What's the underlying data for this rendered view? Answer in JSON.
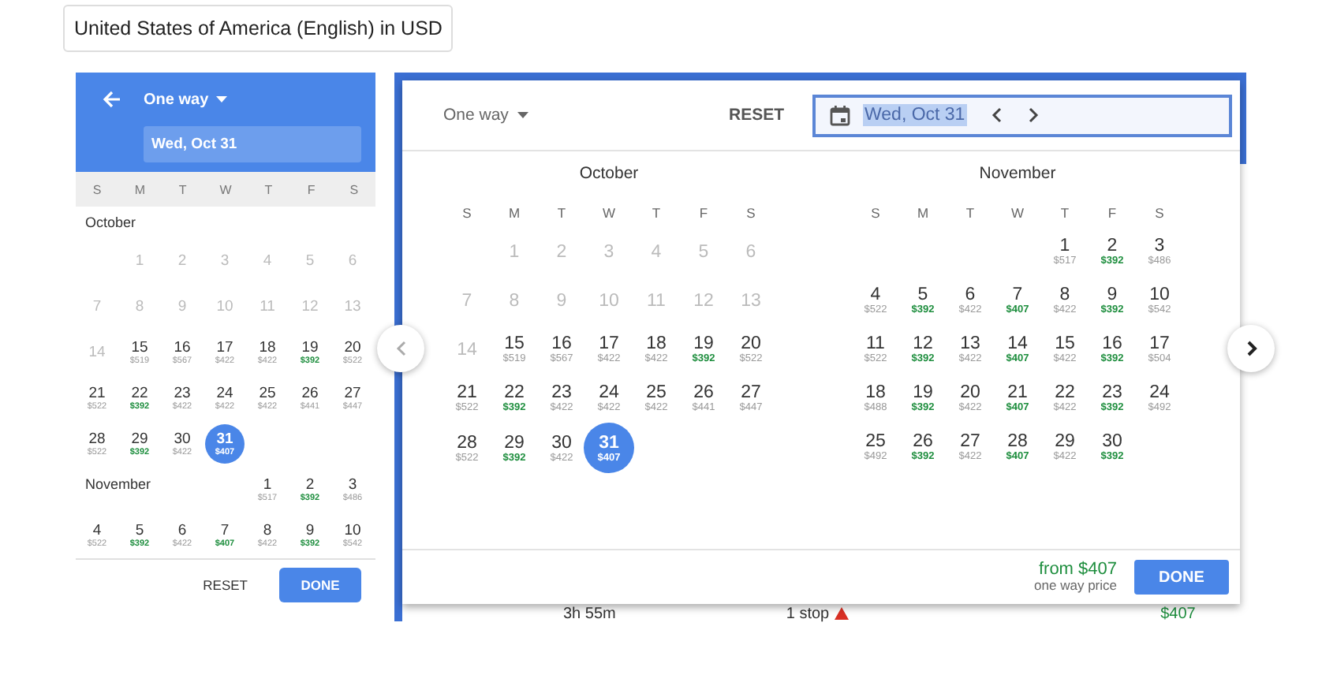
{
  "locale": "United States of America (English) in USD",
  "mobile_picker": {
    "trip_type": "One way",
    "date": "Wed, Oct 31",
    "weekdays": [
      "S",
      "M",
      "T",
      "W",
      "T",
      "F",
      "S"
    ],
    "months": [
      {
        "name": "October",
        "weeks": [
          {
            "kind": "offset",
            "days": [
              {
                "day": "1",
                "disabled": true,
                "selected": false
              },
              {
                "day": "2",
                "disabled": true,
                "selected": false
              },
              {
                "day": "3",
                "disabled": true,
                "selected": false
              },
              {
                "day": "4",
                "disabled": true,
                "selected": false
              },
              {
                "day": "5",
                "disabled": true,
                "selected": false
              },
              {
                "day": "6",
                "disabled": true,
                "selected": false
              }
            ]
          },
          {
            "kind": "plain",
            "days": [
              {
                "day": "7",
                "disabled": true,
                "selected": false
              },
              {
                "day": "8",
                "disabled": true,
                "selected": false
              },
              {
                "day": "9",
                "disabled": true,
                "selected": false
              },
              {
                "day": "10",
                "disabled": true,
                "selected": false
              },
              {
                "day": "11",
                "disabled": true,
                "selected": false
              },
              {
                "day": "12",
                "disabled": true,
                "selected": false
              },
              {
                "day": "13",
                "disabled": true,
                "selected": false
              }
            ]
          },
          {
            "kind": "plain",
            "days": [
              {
                "day": "14",
                "disabled": true,
                "selected": false
              },
              {
                "day": "15",
                "price": "$519",
                "disabled": false,
                "selected": false,
                "low": false
              },
              {
                "day": "16",
                "price": "$567",
                "disabled": false,
                "selected": false,
                "low": false
              },
              {
                "day": "17",
                "price": "$422",
                "disabled": false,
                "selected": false,
                "low": false
              },
              {
                "day": "18",
                "price": "$422",
                "disabled": false,
                "selected": false,
                "low": false
              },
              {
                "day": "19",
                "price": "$392",
                "disabled": false,
                "selected": false,
                "low": true
              },
              {
                "day": "20",
                "price": "$522",
                "disabled": false,
                "selected": false,
                "low": false
              }
            ]
          },
          {
            "kind": "plain",
            "days": [
              {
                "day": "21",
                "price": "$522",
                "disabled": false,
                "selected": false,
                "low": false
              },
              {
                "day": "22",
                "price": "$392",
                "disabled": false,
                "selected": false,
                "low": true
              },
              {
                "day": "23",
                "price": "$422",
                "disabled": false,
                "selected": false,
                "low": false
              },
              {
                "day": "24",
                "price": "$422",
                "disabled": false,
                "selected": false,
                "low": false
              },
              {
                "day": "25",
                "price": "$422",
                "disabled": false,
                "selected": false,
                "low": false
              },
              {
                "day": "26",
                "price": "$441",
                "disabled": false,
                "selected": false,
                "low": false
              },
              {
                "day": "27",
                "price": "$447",
                "disabled": false,
                "selected": false,
                "low": false
              }
            ]
          },
          {
            "kind": "plain",
            "days": [
              {
                "day": "28",
                "price": "$522",
                "disabled": false,
                "selected": false,
                "low": false
              },
              {
                "day": "29",
                "price": "$392",
                "disabled": false,
                "selected": false,
                "low": true
              },
              {
                "day": "30",
                "price": "$422",
                "disabled": false,
                "selected": false,
                "low": false
              },
              {
                "day": "31",
                "price": "$407",
                "disabled": false,
                "selected": true,
                "low": false
              }
            ]
          }
        ]
      },
      {
        "name": "November",
        "weeks": [
          {
            "kind": "offset",
            "days": [
              {
                "day": "1",
                "price": "$517",
                "disabled": false,
                "selected": false,
                "low": false
              },
              {
                "day": "2",
                "price": "$392",
                "disabled": false,
                "selected": false,
                "low": true
              },
              {
                "day": "3",
                "price": "$486",
                "disabled": false,
                "selected": false,
                "low": false
              }
            ]
          },
          {
            "kind": "plain",
            "days": [
              {
                "day": "4",
                "price": "$522",
                "disabled": false,
                "selected": false,
                "low": false
              },
              {
                "day": "5",
                "price": "$392",
                "disabled": false,
                "selected": false,
                "low": true
              },
              {
                "day": "6",
                "price": "$422",
                "disabled": false,
                "selected": false,
                "low": false
              },
              {
                "day": "7",
                "price": "$407",
                "disabled": false,
                "selected": false,
                "low": true
              },
              {
                "day": "8",
                "price": "$422",
                "disabled": false,
                "selected": false,
                "low": false
              },
              {
                "day": "9",
                "price": "$392",
                "disabled": false,
                "selected": false,
                "low": true
              },
              {
                "day": "10",
                "price": "$542",
                "disabled": false,
                "selected": false,
                "low": false
              }
            ]
          }
        ]
      }
    ],
    "reset": "RESET",
    "done": "DONE"
  },
  "desktop_picker": {
    "trip_type": "One way",
    "reset": "RESET",
    "date": "Wed, Oct 31",
    "months": [
      {
        "name": "October",
        "weekdays": [
          "S",
          "M",
          "T",
          "W",
          "T",
          "F",
          "S"
        ],
        "weeks": [
          {
            "kind": "offset",
            "days": [
              {
                "day": "1",
                "disabled": true,
                "selected": false
              },
              {
                "day": "2",
                "disabled": true,
                "selected": false
              },
              {
                "day": "3",
                "disabled": true,
                "selected": false
              },
              {
                "day": "4",
                "disabled": true,
                "selected": false
              },
              {
                "day": "5",
                "disabled": true,
                "selected": false
              },
              {
                "day": "6",
                "disabled": true,
                "selected": false
              }
            ]
          },
          {
            "kind": "plain",
            "days": [
              {
                "day": "7",
                "disabled": true,
                "selected": false
              },
              {
                "day": "8",
                "disabled": true,
                "selected": false
              },
              {
                "day": "9",
                "disabled": true,
                "selected": false
              },
              {
                "day": "10",
                "disabled": true,
                "selected": false
              },
              {
                "day": "11",
                "disabled": true,
                "selected": false
              },
              {
                "day": "12",
                "disabled": true,
                "selected": false
              },
              {
                "day": "13",
                "disabled": true,
                "selected": false
              }
            ]
          },
          {
            "kind": "plain",
            "days": [
              {
                "day": "14",
                "disabled": true,
                "selected": false
              },
              {
                "day": "15",
                "price": "$519",
                "disabled": false,
                "selected": false,
                "low": false
              },
              {
                "day": "16",
                "price": "$567",
                "disabled": false,
                "selected": false,
                "low": false
              },
              {
                "day": "17",
                "price": "$422",
                "disabled": false,
                "selected": false,
                "low": false
              },
              {
                "day": "18",
                "price": "$422",
                "disabled": false,
                "selected": false,
                "low": false
              },
              {
                "day": "19",
                "price": "$392",
                "disabled": false,
                "selected": false,
                "low": true
              },
              {
                "day": "20",
                "price": "$522",
                "disabled": false,
                "selected": false,
                "low": false
              }
            ]
          },
          {
            "kind": "plain",
            "days": [
              {
                "day": "21",
                "price": "$522",
                "disabled": false,
                "selected": false,
                "low": false
              },
              {
                "day": "22",
                "price": "$392",
                "disabled": false,
                "selected": false,
                "low": true
              },
              {
                "day": "23",
                "price": "$422",
                "disabled": false,
                "selected": false,
                "low": false
              },
              {
                "day": "24",
                "price": "$422",
                "disabled": false,
                "selected": false,
                "low": false
              },
              {
                "day": "25",
                "price": "$422",
                "disabled": false,
                "selected": false,
                "low": false
              },
              {
                "day": "26",
                "price": "$441",
                "disabled": false,
                "selected": false,
                "low": false
              },
              {
                "day": "27",
                "price": "$447",
                "disabled": false,
                "selected": false,
                "low": false
              }
            ]
          },
          {
            "kind": "plain",
            "days": [
              {
                "day": "28",
                "price": "$522",
                "disabled": false,
                "selected": false,
                "low": false
              },
              {
                "day": "29",
                "price": "$392",
                "disabled": false,
                "selected": false,
                "low": true
              },
              {
                "day": "30",
                "price": "$422",
                "disabled": false,
                "selected": false,
                "low": false
              },
              {
                "day": "31",
                "price": "$407",
                "disabled": false,
                "selected": true,
                "low": false
              }
            ]
          }
        ]
      },
      {
        "name": "November",
        "weekdays": [
          "S",
          "M",
          "T",
          "W",
          "T",
          "F",
          "S"
        ],
        "weeks": [
          {
            "kind": "offset",
            "days": [
              {
                "day": "1",
                "price": "$517",
                "disabled": false,
                "selected": false,
                "low": false
              },
              {
                "day": "2",
                "price": "$392",
                "disabled": false,
                "selected": false,
                "low": true
              },
              {
                "day": "3",
                "price": "$486",
                "disabled": false,
                "selected": false,
                "low": false
              }
            ]
          },
          {
            "kind": "plain",
            "days": [
              {
                "day": "4",
                "price": "$522",
                "disabled": false,
                "selected": false,
                "low": false
              },
              {
                "day": "5",
                "price": "$392",
                "disabled": false,
                "selected": false,
                "low": true
              },
              {
                "day": "6",
                "price": "$422",
                "disabled": false,
                "selected": false,
                "low": false
              },
              {
                "day": "7",
                "price": "$407",
                "disabled": false,
                "selected": false,
                "low": true
              },
              {
                "day": "8",
                "price": "$422",
                "disabled": false,
                "selected": false,
                "low": false
              },
              {
                "day": "9",
                "price": "$392",
                "disabled": false,
                "selected": false,
                "low": true
              },
              {
                "day": "10",
                "price": "$542",
                "disabled": false,
                "selected": false,
                "low": false
              }
            ]
          },
          {
            "kind": "plain",
            "days": [
              {
                "day": "11",
                "price": "$522",
                "disabled": false,
                "selected": false,
                "low": false
              },
              {
                "day": "12",
                "price": "$392",
                "disabled": false,
                "selected": false,
                "low": true
              },
              {
                "day": "13",
                "price": "$422",
                "disabled": false,
                "selected": false,
                "low": false
              },
              {
                "day": "14",
                "price": "$407",
                "disabled": false,
                "selected": false,
                "low": true
              },
              {
                "day": "15",
                "price": "$422",
                "disabled": false,
                "selected": false,
                "low": false
              },
              {
                "day": "16",
                "price": "$392",
                "disabled": false,
                "selected": false,
                "low": true
              },
              {
                "day": "17",
                "price": "$504",
                "disabled": false,
                "selected": false,
                "low": false
              }
            ]
          },
          {
            "kind": "plain",
            "days": [
              {
                "day": "18",
                "price": "$488",
                "disabled": false,
                "selected": false,
                "low": false
              },
              {
                "day": "19",
                "price": "$392",
                "disabled": false,
                "selected": false,
                "low": true
              },
              {
                "day": "20",
                "price": "$422",
                "disabled": false,
                "selected": false,
                "low": false
              },
              {
                "day": "21",
                "price": "$407",
                "disabled": false,
                "selected": false,
                "low": true
              },
              {
                "day": "22",
                "price": "$422",
                "disabled": false,
                "selected": false,
                "low": false
              },
              {
                "day": "23",
                "price": "$392",
                "disabled": false,
                "selected": false,
                "low": true
              },
              {
                "day": "24",
                "price": "$492",
                "disabled": false,
                "selected": false,
                "low": false
              }
            ]
          },
          {
            "kind": "plain",
            "days": [
              {
                "day": "25",
                "price": "$492",
                "disabled": false,
                "selected": false,
                "low": false
              },
              {
                "day": "26",
                "price": "$392",
                "disabled": false,
                "selected": false,
                "low": true
              },
              {
                "day": "27",
                "price": "$422",
                "disabled": false,
                "selected": false,
                "low": false
              },
              {
                "day": "28",
                "price": "$407",
                "disabled": false,
                "selected": false,
                "low": true
              },
              {
                "day": "29",
                "price": "$422",
                "disabled": false,
                "selected": false,
                "low": false
              },
              {
                "day": "30",
                "price": "$392",
                "disabled": false,
                "selected": false,
                "low": true
              }
            ]
          }
        ]
      }
    ],
    "from_price": "from $407",
    "price_note": "one way price",
    "done": "DONE"
  },
  "background_results": {
    "duration": "3h 55m",
    "stops": "1 stop",
    "price": "$407"
  }
}
